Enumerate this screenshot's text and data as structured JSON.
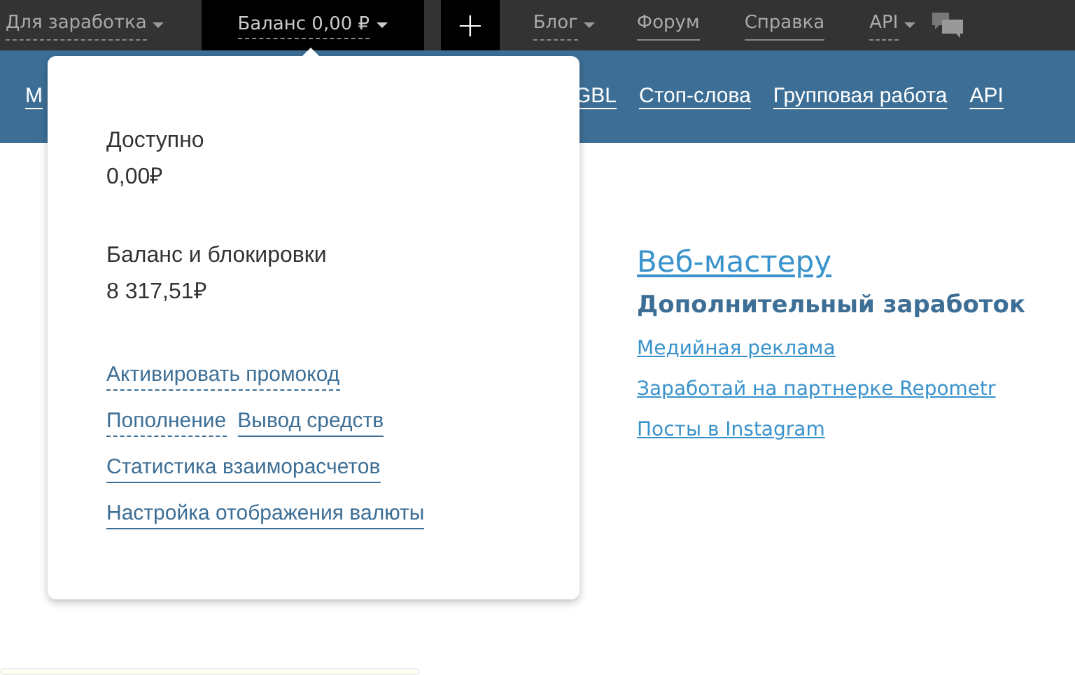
{
  "top_nav": [
    {
      "kind": "dropdown",
      "label": "Для заработка"
    },
    {
      "kind": "balance",
      "label": "Баланс 0,00 ₽"
    },
    {
      "kind": "add",
      "label": "+"
    },
    {
      "kind": "dropdown",
      "label": "Блог"
    },
    {
      "kind": "link",
      "label": "Форум"
    },
    {
      "kind": "link",
      "label": "Справка"
    },
    {
      "kind": "dropdown",
      "label": "API"
    },
    {
      "kind": "chat"
    }
  ],
  "sub_nav": [
    "М",
    "GBL",
    "Стоп-слова",
    "Групповая работа",
    "API"
  ],
  "balance_menu": {
    "sections": [
      {
        "label": "Доступно",
        "amount": "0,00₽"
      },
      {
        "label": "Баланс и блокировки",
        "amount": "8 317,51₽"
      }
    ],
    "link_rows": [
      [
        {
          "label": "Активировать промокод",
          "dashed": true
        }
      ],
      [
        {
          "label": "Пополнение",
          "dashed": true
        },
        {
          "label": "Вывод средств",
          "dashed": false
        }
      ],
      [
        {
          "label": "Статистика взаиморасчетов",
          "dashed": false
        }
      ],
      [
        {
          "label": "Настройка отображения валюты",
          "dashed": false
        }
      ]
    ]
  },
  "webmaster": {
    "title": "Веб-мастеру",
    "subtitle": "Дополнительный заработок",
    "links": [
      "Медийная реклама",
      "Заработай на партнерке Repometr",
      "Посты в Instagram"
    ]
  }
}
